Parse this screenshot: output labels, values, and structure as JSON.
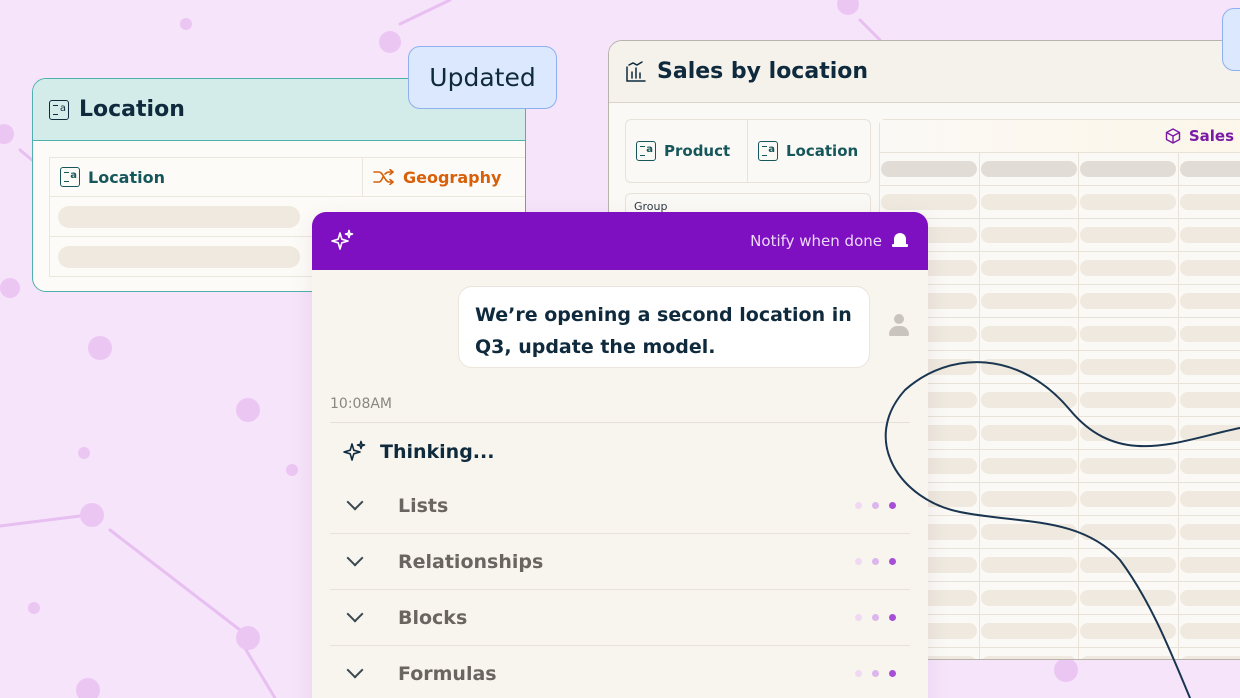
{
  "location_card": {
    "title": "Location",
    "icon": "list-icon",
    "columns": [
      {
        "label": "Location",
        "icon": "list-icon"
      },
      {
        "label": "Geography",
        "icon": "shuffle-icon"
      }
    ],
    "badge": "Updated"
  },
  "sales_card": {
    "title": "Sales by location",
    "icon": "chart-icon",
    "dimensions": [
      {
        "label": "Product",
        "icon": "list-icon"
      },
      {
        "label": "Location",
        "icon": "list-icon"
      }
    ],
    "group_label": "Group",
    "measure": {
      "label": "Sales",
      "icon": "cube-icon"
    }
  },
  "assistant": {
    "notify_label": "Notify when done",
    "header_icon": "sparkle-icon",
    "bell_icon": "bell-icon",
    "message": "We’re opening a second location in Q3, update the model.",
    "timestamp": "10:08AM",
    "thinking_label": "Thinking...",
    "steps": [
      {
        "label": "Lists"
      },
      {
        "label": "Relationships"
      },
      {
        "label": "Blocks"
      },
      {
        "label": "Formulas"
      }
    ]
  },
  "colors": {
    "background": "#f6e4fa",
    "assistant_header": "#7e10c2",
    "location_accent": "#4fb0ad",
    "geography_orange": "#d8600a",
    "sales_purple": "#7a1aa6",
    "badge_blue": "#dce8fd"
  }
}
